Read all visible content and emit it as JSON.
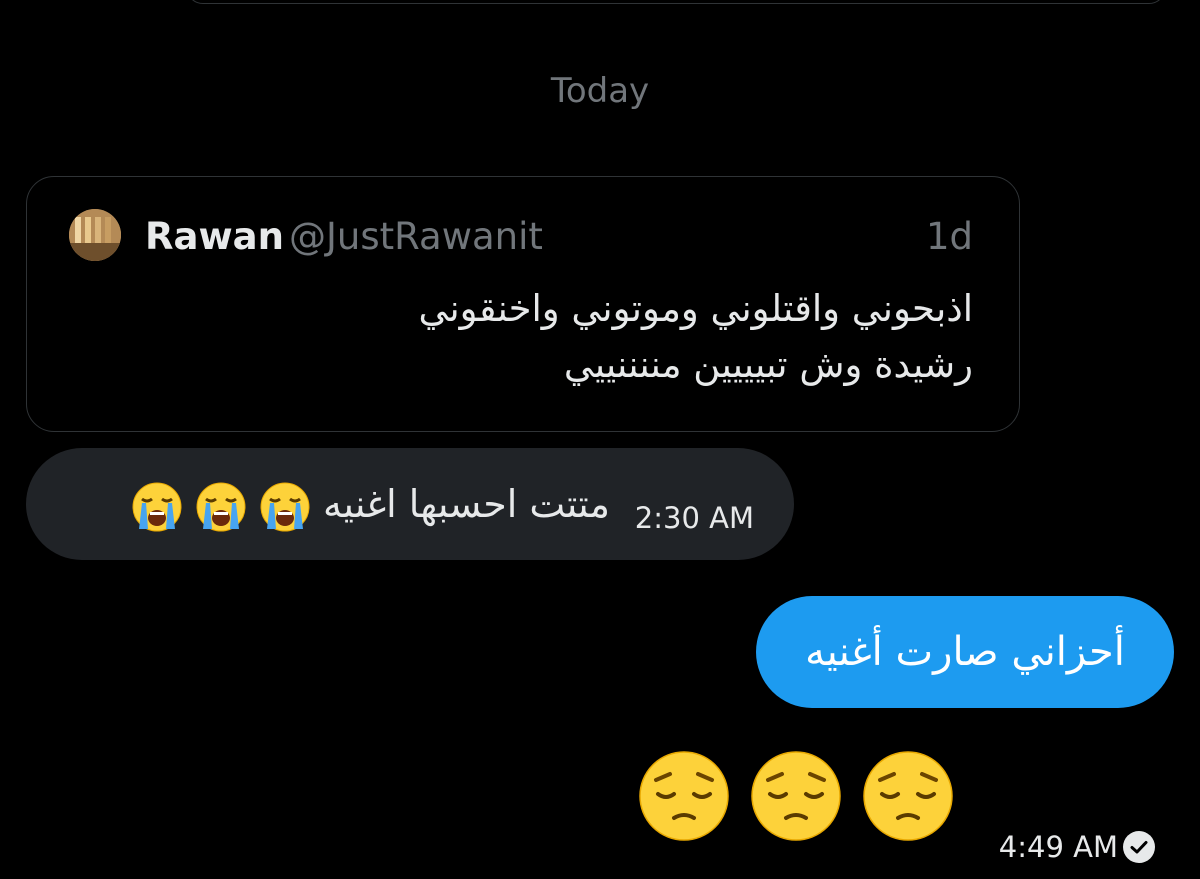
{
  "date_separator": "Today",
  "quoted_tweet": {
    "name": "Rawan",
    "handle": "@JustRawanit",
    "time": "1d",
    "lines": [
      "اذبحوني واقتلوني وموتوني واخنقوني",
      "رشيدة وش تبيييين مننننييي"
    ]
  },
  "incoming_message": {
    "text": "متتت احسبها اغنيه",
    "emoji": [
      "loudly-crying-face",
      "loudly-crying-face",
      "loudly-crying-face"
    ],
    "time": "2:30 AM"
  },
  "outgoing_message": {
    "text": "أحزاني صارت أغنيه"
  },
  "outgoing_emoji": {
    "emoji": [
      "pensive-face",
      "pensive-face",
      "pensive-face"
    ],
    "time": "4:49 AM"
  },
  "colors": {
    "background": "#000000",
    "outgoing_bubble": "#1d9bf0",
    "incoming_bubble": "#202327",
    "muted_text": "#71767b",
    "card_border": "#2f3336"
  }
}
